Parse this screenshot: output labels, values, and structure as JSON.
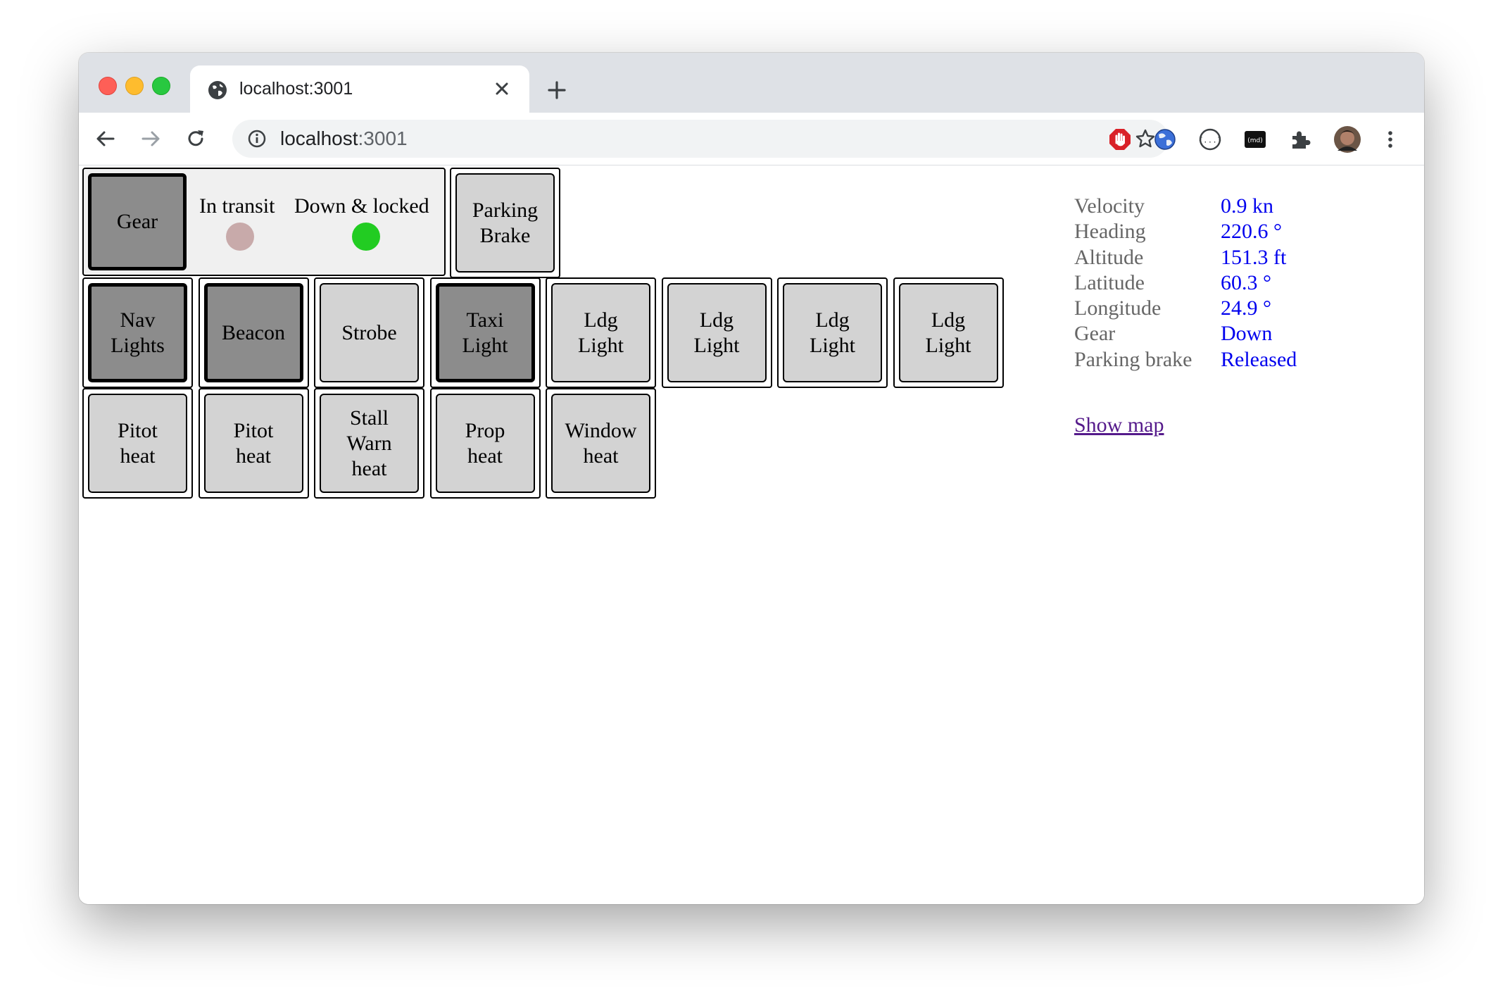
{
  "browser": {
    "tab_title": "localhost:3001",
    "url_host": "localhost",
    "url_port": ":3001"
  },
  "gear": {
    "button_label": "Gear",
    "in_transit_label": "In transit",
    "down_locked_label": "Down & locked",
    "in_transit_color": "#c8aaaa",
    "down_locked_color": "#22cc22"
  },
  "parking_brake": {
    "label": "Parking\nBrake"
  },
  "row2": [
    {
      "label": "Nav\nLights",
      "on": true
    },
    {
      "label": "Beacon",
      "on": true
    },
    {
      "label": "Strobe",
      "on": false
    },
    {
      "label": "Taxi\nLight",
      "on": true
    },
    {
      "label": "Ldg\nLight",
      "on": false
    },
    {
      "label": "Ldg\nLight",
      "on": false
    },
    {
      "label": "Ldg\nLight",
      "on": false
    },
    {
      "label": "Ldg\nLight",
      "on": false
    }
  ],
  "row3": [
    {
      "label": "Pitot\nheat",
      "on": false
    },
    {
      "label": "Pitot\nheat",
      "on": false
    },
    {
      "label": "Stall\nWarn\nheat",
      "on": false
    },
    {
      "label": "Prop\nheat",
      "on": false
    },
    {
      "label": "Window\nheat",
      "on": false
    }
  ],
  "stats": {
    "velocity": {
      "label": "Velocity",
      "value": "0.9 kn"
    },
    "heading": {
      "label": "Heading",
      "value": "220.6 °"
    },
    "altitude": {
      "label": "Altitude",
      "value": "151.3 ft"
    },
    "latitude": {
      "label": "Latitude",
      "value": "60.3 °"
    },
    "longitude": {
      "label": "Longitude",
      "value": "24.9 °"
    },
    "gear": {
      "label": "Gear",
      "value": "Down"
    },
    "parking_brake": {
      "label": "Parking brake",
      "value": "Released"
    }
  },
  "show_map_label": "Show map"
}
